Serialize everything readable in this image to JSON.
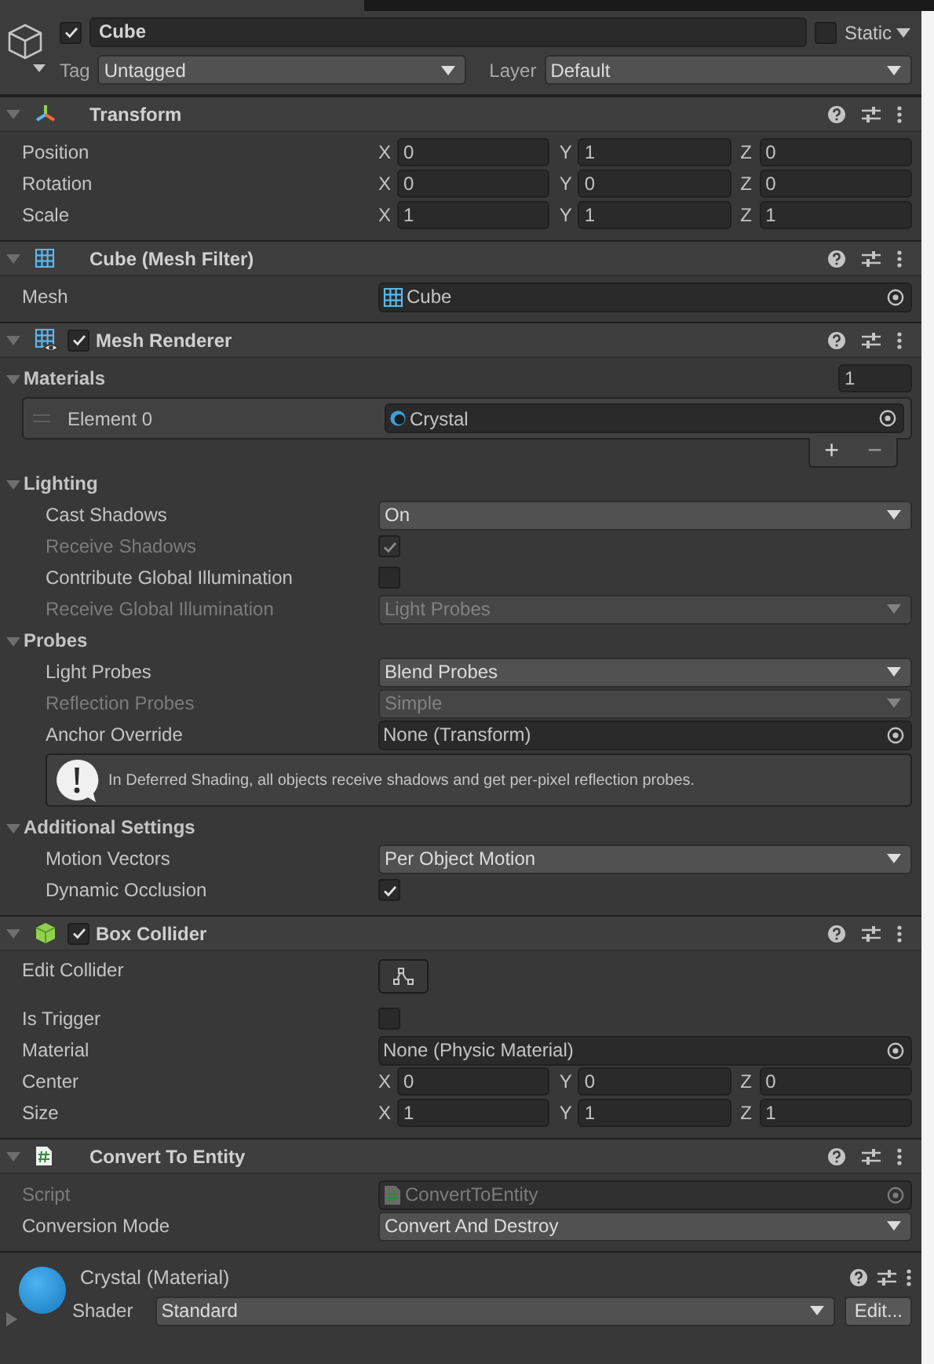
{
  "header": {
    "active": true,
    "name": "Cube",
    "static": false,
    "static_label": "Static",
    "tag_label": "Tag",
    "tag": "Untagged",
    "layer_label": "Layer",
    "layer": "Default"
  },
  "components": [
    {
      "kind": "transform",
      "title": "Transform",
      "expanded": true,
      "rows": [
        {
          "kind": "vector",
          "label": "Position",
          "fields": [
            {
              "axis": "X",
              "value": "0"
            },
            {
              "axis": "Y",
              "value": "1"
            },
            {
              "axis": "Z",
              "value": "0"
            }
          ]
        },
        {
          "kind": "vector",
          "label": "Rotation",
          "fields": [
            {
              "axis": "X",
              "value": "0"
            },
            {
              "axis": "Y",
              "value": "0"
            },
            {
              "axis": "Z",
              "value": "0"
            }
          ]
        },
        {
          "kind": "vector",
          "label": "Scale",
          "fields": [
            {
              "axis": "X",
              "value": "1"
            },
            {
              "axis": "Y",
              "value": "1"
            },
            {
              "axis": "Z",
              "value": "1"
            }
          ]
        }
      ]
    },
    {
      "kind": "mesh_filter",
      "title": "Cube (Mesh Filter)",
      "expanded": true,
      "rows": [
        {
          "kind": "object",
          "label": "Mesh",
          "value": "Cube",
          "disabled": false
        }
      ]
    },
    {
      "kind": "mesh_renderer",
      "title": "Mesh Renderer",
      "enabled": true,
      "expanded": true,
      "rows": [
        {
          "kind": "list",
          "label": "Materials",
          "expanded": true,
          "count": "1",
          "add": "+",
          "remove": "−",
          "items": [
            {
              "label": "Element 0",
              "value": "Crystal"
            }
          ]
        },
        {
          "kind": "section",
          "label": "Lighting",
          "expanded": true,
          "children": [
            {
              "kind": "dropdown",
              "label": "Cast Shadows",
              "value": "On",
              "disabled": false
            },
            {
              "kind": "checkbox",
              "label": "Receive Shadows",
              "checked": true,
              "disabled": true
            },
            {
              "kind": "checkbox",
              "label": "Contribute Global Illumination",
              "checked": false,
              "disabled": false
            },
            {
              "kind": "dropdown",
              "label": "Receive Global Illumination",
              "value": "Light Probes",
              "disabled": true
            }
          ]
        },
        {
          "kind": "section",
          "label": "Probes",
          "expanded": true,
          "children": [
            {
              "kind": "dropdown",
              "label": "Light Probes",
              "value": "Blend Probes",
              "disabled": false
            },
            {
              "kind": "dropdown",
              "label": "Reflection Probes",
              "value": "Simple",
              "disabled": true
            },
            {
              "kind": "object",
              "label": "Anchor Override",
              "value": "None (Transform)",
              "disabled": false
            },
            {
              "kind": "help",
              "text": "In Deferred Shading, all objects receive shadows and get per-pixel reflection probes."
            }
          ]
        },
        {
          "kind": "section",
          "label": "Additional Settings",
          "expanded": true,
          "children": [
            {
              "kind": "dropdown",
              "label": "Motion Vectors",
              "value": "Per Object Motion",
              "disabled": false
            },
            {
              "kind": "checkbox",
              "label": "Dynamic Occlusion",
              "checked": true,
              "disabled": false
            }
          ]
        }
      ]
    },
    {
      "kind": "box_collider",
      "title": "Box Collider",
      "enabled": true,
      "expanded": true,
      "rows": [
        {
          "kind": "button",
          "label": "Edit Collider"
        },
        {
          "kind": "checkbox",
          "label": "Is Trigger",
          "checked": false,
          "disabled": false
        },
        {
          "kind": "object",
          "label": "Material",
          "value": "None (Physic Material)",
          "disabled": false
        },
        {
          "kind": "vector",
          "label": "Center",
          "fields": [
            {
              "axis": "X",
              "value": "0"
            },
            {
              "axis": "Y",
              "value": "0"
            },
            {
              "axis": "Z",
              "value": "0"
            }
          ]
        },
        {
          "kind": "vector",
          "label": "Size",
          "fields": [
            {
              "axis": "X",
              "value": "1"
            },
            {
              "axis": "Y",
              "value": "1"
            },
            {
              "axis": "Z",
              "value": "1"
            }
          ]
        }
      ]
    },
    {
      "kind": "script",
      "title": "Convert To Entity",
      "expanded": true,
      "rows": [
        {
          "kind": "object",
          "label": "Script",
          "value": "ConvertToEntity",
          "disabled": true
        },
        {
          "kind": "dropdown",
          "label": "Conversion Mode",
          "value": "Convert And Destroy",
          "disabled": false
        }
      ]
    }
  ],
  "material": {
    "title": "Crystal (Material)",
    "expanded": false,
    "shader_label": "Shader",
    "shader": "Standard",
    "edit": "Edit..."
  }
}
